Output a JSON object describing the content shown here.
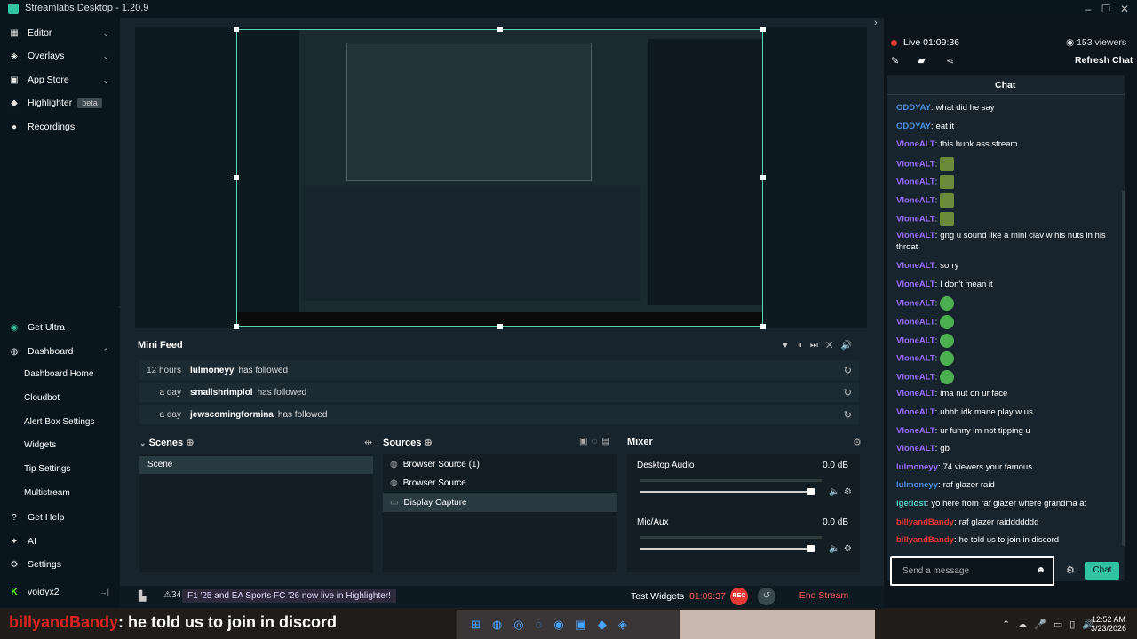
{
  "app": {
    "title": "Streamlabs Desktop - 1.20.9"
  },
  "sidebar": {
    "items": [
      {
        "label": "Editor",
        "icon": "editor-icon"
      },
      {
        "label": "Overlays",
        "icon": "overlays-icon"
      },
      {
        "label": "App Store",
        "icon": "app-store-icon"
      },
      {
        "label": "Highlighter",
        "icon": "highlighter-icon",
        "badge": "beta"
      },
      {
        "label": "Recordings",
        "icon": "recordings-icon"
      }
    ],
    "get_ultra": "Get Ultra",
    "dashboard": "Dashboard",
    "dashboard_items": [
      "Dashboard Home",
      "Cloudbot",
      "Alert Box Settings",
      "Widgets",
      "Tip Settings",
      "Multistream"
    ],
    "get_help": "Get Help",
    "ai": "AI",
    "settings": "Settings",
    "user": "voidyx2"
  },
  "minifeed": {
    "title": "Mini Feed",
    "rows": [
      {
        "time": "12 hours",
        "name": "lulmoneyy",
        "action": "has followed"
      },
      {
        "time": "a day",
        "name": "smallshrimplol",
        "action": "has followed"
      },
      {
        "time": "a day",
        "name": "jewscomingformina",
        "action": "has followed"
      }
    ]
  },
  "scenes": {
    "title": "Scenes",
    "items": [
      "Scene"
    ]
  },
  "sources": {
    "title": "Sources",
    "items": [
      "Browser Source (1)",
      "Browser Source",
      "Display Capture"
    ]
  },
  "mixer": {
    "title": "Mixer",
    "channels": [
      {
        "name": "Desktop Audio",
        "db": "0.0 dB",
        "level": 1.0
      },
      {
        "name": "Mic/Aux",
        "db": "0.0 dB",
        "level": 1.0
      }
    ]
  },
  "bottombar": {
    "count": "34",
    "news": "F1 '25 and EA Sports FC '26 now live in Highlighter!",
    "test_widgets": "Test Widgets",
    "timer": "01:09:37",
    "rec": "REC",
    "end_stream": "End Stream"
  },
  "chatpanel": {
    "live": "Live 01:09:36",
    "viewers": "153 viewers",
    "refresh": "Refresh Chat",
    "title": "Chat",
    "messages": [
      {
        "user": "ODDYAY",
        "color": "#4a90e2",
        "text": "what did he say"
      },
      {
        "user": "ODDYAY",
        "color": "#4a90e2",
        "text": "eat it"
      },
      {
        "user": "VloneALT",
        "color": "#9b6bff",
        "text": "this bunk ass stream"
      },
      {
        "user": "VloneALT",
        "color": "#9b6bff",
        "text": "",
        "emote": "frog"
      },
      {
        "user": "VloneALT",
        "color": "#9b6bff",
        "text": "",
        "emote": "frog"
      },
      {
        "user": "VloneALT",
        "color": "#9b6bff",
        "text": "",
        "emote": "frog"
      },
      {
        "user": "VloneALT",
        "color": "#9b6bff",
        "text": "",
        "emote": "frog"
      },
      {
        "user": "VloneALT",
        "color": "#9b6bff",
        "text": "gng u sound like a mini clav w his nuts in his throat"
      },
      {
        "user": "VloneALT",
        "color": "#9b6bff",
        "text": "sorry"
      },
      {
        "user": "VloneALT",
        "color": "#9b6bff",
        "text": "I don't mean it"
      },
      {
        "user": "VloneALT",
        "color": "#9b6bff",
        "text": "",
        "emote": "green"
      },
      {
        "user": "VloneALT",
        "color": "#9b6bff",
        "text": "",
        "emote": "green"
      },
      {
        "user": "VloneALT",
        "color": "#9b6bff",
        "text": "",
        "emote": "green"
      },
      {
        "user": "VloneALT",
        "color": "#9b6bff",
        "text": "",
        "emote": "green"
      },
      {
        "user": "VloneALT",
        "color": "#9b6bff",
        "text": "",
        "emote": "green"
      },
      {
        "user": "VloneALT",
        "color": "#9b6bff",
        "text": "ima nut on ur face"
      },
      {
        "user": "VloneALT",
        "color": "#9b6bff",
        "text": "uhhh idk mane play w us"
      },
      {
        "user": "VloneALT",
        "color": "#9b6bff",
        "text": "ur funny im not tipping u"
      },
      {
        "user": "VloneALT",
        "color": "#9b6bff",
        "text": "gb"
      },
      {
        "user": "lulmoneyy",
        "color": "#9b6bff",
        "text": "74 viewers your famous"
      },
      {
        "user": "lulmoneyy",
        "color": "#4a90e2",
        "text": "raf glazer raid"
      },
      {
        "user": "lgetlost",
        "color": "#4fd1c5",
        "text": "yo here from raf glazer where grandma at"
      },
      {
        "user": "billyandBandy",
        "color": "#e53935",
        "text": "raf glazer raiddddddd"
      },
      {
        "user": "billyandBandy",
        "color": "#e53935",
        "text": "he told us to join in discord"
      }
    ],
    "input_placeholder": "Send a message",
    "send": "Chat"
  },
  "overlay": {
    "user": "billyandBandy",
    "text": ": he told us to join in discord"
  },
  "taskbar": {
    "time": "12:52 AM",
    "date": "3/23/2026"
  }
}
